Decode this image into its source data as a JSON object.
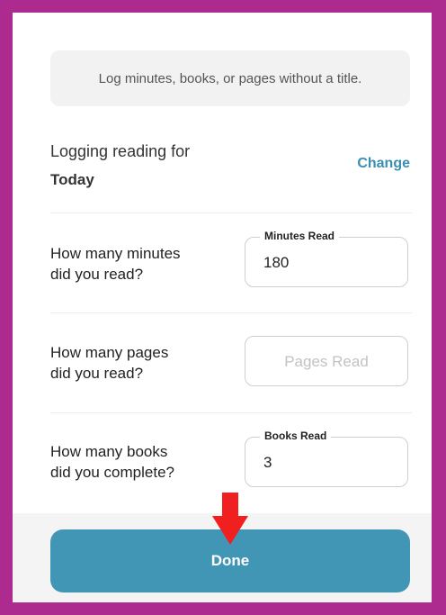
{
  "info_note": "Log minutes, books, or pages without a title.",
  "logging": {
    "label": "Logging reading for",
    "value": "Today",
    "change_label": "Change"
  },
  "fields": {
    "minutes": {
      "question_line1": "How many minutes",
      "question_line2": "did you read?",
      "legend": "Minutes Read",
      "value": "180"
    },
    "pages": {
      "question_line1": "How many pages",
      "question_line2": "did you read?",
      "placeholder": "Pages Read"
    },
    "books": {
      "question_line1": "How many books",
      "question_line2": "did you complete?",
      "legend": "Books Read",
      "value": "3"
    }
  },
  "done_label": "Done",
  "colors": {
    "border": "#ad2a8e",
    "accent": "#3a8fb0",
    "button": "#4196b5",
    "arrow": "#f02020"
  }
}
